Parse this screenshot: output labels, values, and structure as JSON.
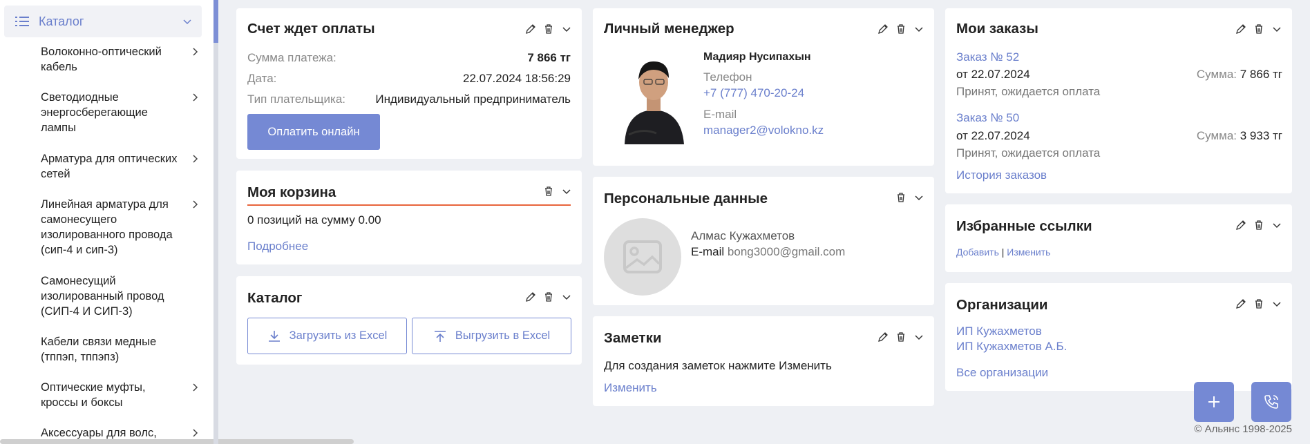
{
  "sidebar": {
    "catalog_title": "Каталог",
    "items": [
      {
        "label": "Волоконно-оптический кабель"
      },
      {
        "label": "Светодиодные энергосберегающие лампы"
      },
      {
        "label": "Арматура для оптических сетей"
      },
      {
        "label": "Линейная арматура для самонесущего изолированного провода (сип-4 и сип-3)"
      },
      {
        "label": "Самонесущий изолированный провод (СИП-4 И СИП-3)"
      },
      {
        "label": "Кабели связи медные (тппэп, тппэпз)"
      },
      {
        "label": "Оптические муфты, кроссы и боксы"
      },
      {
        "label": "Аксессуары для волс,"
      }
    ]
  },
  "invoice": {
    "title": "Счет ждет оплаты",
    "amount_label": "Сумма платежа:",
    "amount_value": "7 866 тг",
    "date_label": "Дата:",
    "date_value": "22.07.2024 18:56:29",
    "payer_label": "Тип плательщика:",
    "payer_value": "Индивидуальный предприниматель",
    "pay_button": "Оплатить онлайн"
  },
  "cart": {
    "title": "Моя корзина",
    "summary": "0 позиций на сумму 0.00",
    "more_link": "Подробнее"
  },
  "catalog_card": {
    "title": "Каталог",
    "upload_button": "Загрузить из Excel",
    "download_button": "Выгрузить в Excel"
  },
  "manager": {
    "title": "Личный менеджер",
    "name": "Мадияр Нусипахын",
    "phone_label": "Телефон",
    "phone": "+7 (777) 470-20-24",
    "email_label": "E-mail",
    "email": "manager2@volokno.kz"
  },
  "personal": {
    "title": "Персональные данные",
    "name": "Алмас Кужахметов",
    "email_label": "E-mail",
    "email": "bong3000@gmail.com"
  },
  "notes": {
    "title": "Заметки",
    "text": "Для создания заметок нажмите Изменить",
    "edit_link": "Изменить"
  },
  "orders": {
    "title": "Мои заказы",
    "sum_label": "Сумма:",
    "list": [
      {
        "number": "Заказ № 52",
        "date": "от 22.07.2024",
        "sum": "7 866 тг",
        "status": "Принят, ожидается оплата"
      },
      {
        "number": "Заказ № 50",
        "date": "от 22.07.2024",
        "sum": "3 933 тг",
        "status": "Принят, ожидается оплата"
      }
    ],
    "history_link": "История заказов"
  },
  "favorites": {
    "title": "Избранные ссылки",
    "add_link": "Добавить",
    "separator": "|",
    "edit_link": "Изменить"
  },
  "organizations": {
    "title": "Организации",
    "list": [
      "ИП Кужахметов",
      "ИП Кужахметов А.Б."
    ],
    "all_link": "Все организации"
  },
  "footer": {
    "copyright": "© Альянс 1998-2025"
  },
  "colors": {
    "accent": "#7589d4",
    "link": "#6a7fcc",
    "cart_underline": "#e8643a",
    "background": "#eef0f4"
  },
  "icons": [
    "menu-list-icon",
    "chevron-down-icon",
    "chevron-right-icon",
    "pencil-icon",
    "trash-icon",
    "upload-icon",
    "download-icon",
    "plus-icon",
    "phone-icon",
    "image-placeholder-icon"
  ]
}
